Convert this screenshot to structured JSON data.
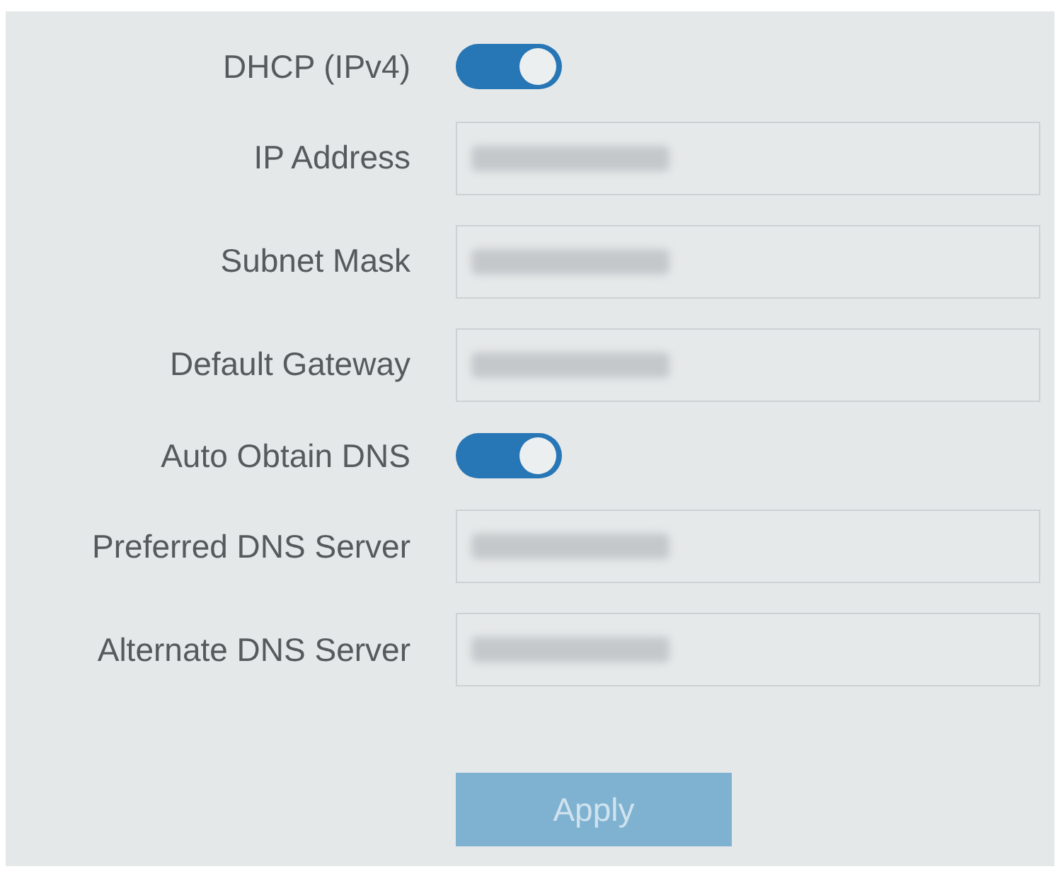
{
  "settings": [
    {
      "kind": "toggle",
      "label": "DHCP (IPv4)",
      "on": true
    },
    {
      "kind": "field",
      "label": "IP Address",
      "redacted": true
    },
    {
      "kind": "field",
      "label": "Subnet Mask",
      "redacted": true
    },
    {
      "kind": "field",
      "label": "Default Gateway",
      "redacted": true
    },
    {
      "kind": "toggle",
      "label": "Auto Obtain DNS",
      "on": true
    },
    {
      "kind": "field",
      "label": "Preferred DNS Server",
      "redacted": true
    },
    {
      "kind": "field",
      "label": "Alternate DNS Server",
      "redacted": true
    }
  ],
  "apply_button": {
    "label": "Apply",
    "disabled": true
  }
}
